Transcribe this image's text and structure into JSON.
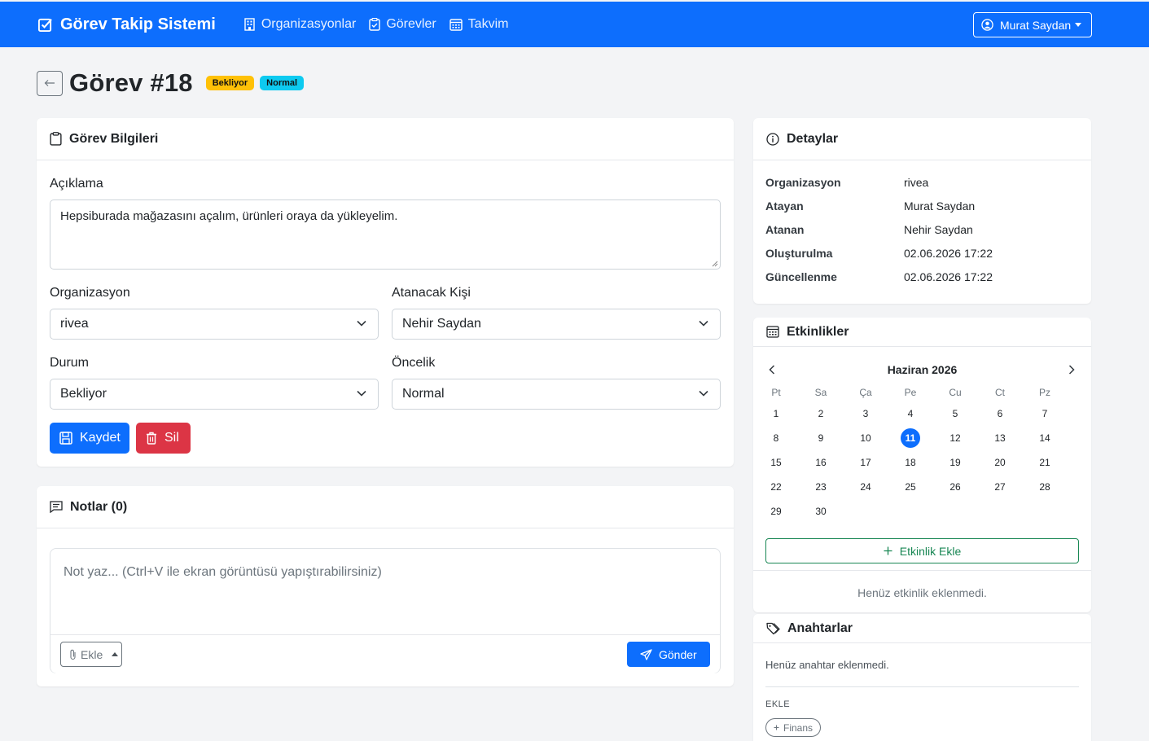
{
  "navbar": {
    "brand": "Görev Takip Sistemi",
    "links": [
      "Organizasyonlar",
      "Görevler",
      "Takvim"
    ],
    "user": "Murat Saydan"
  },
  "page": {
    "title": "Görev #18",
    "status_badge": "Bekliyor",
    "priority_badge": "Normal"
  },
  "task_info": {
    "title": "Görev Bilgileri",
    "description_label": "Açıklama",
    "description": "Hepsiburada mağazasını açalım, ürünleri oraya da yükleyelim.",
    "organization_label": "Organizasyon",
    "organization": "rivea",
    "assignee_label": "Atanacak Kişi",
    "assignee": "Nehir Saydan",
    "status_label": "Durum",
    "status": "Bekliyor",
    "priority_label": "Öncelik",
    "priority": "Normal",
    "save_label": "Kaydet",
    "delete_label": "Sil"
  },
  "notes": {
    "title": "Notlar (0)",
    "placeholder": "Not yaz... (Ctrl+V ile ekran görüntüsü yapıştırabilirsiniz)",
    "attach_label": "Ekle",
    "send_label": "Gönder"
  },
  "details": {
    "title": "Detaylar",
    "rows": [
      {
        "key": "Organizasyon",
        "value": "rivea"
      },
      {
        "key": "Atayan",
        "value": "Murat Saydan"
      },
      {
        "key": "Atanan",
        "value": "Nehir Saydan"
      },
      {
        "key": "Oluşturulma",
        "value": "02.06.2026 17:22"
      },
      {
        "key": "Güncellenme",
        "value": "02.06.2026 17:22"
      }
    ]
  },
  "events": {
    "title": "Etkinlikler",
    "month": "Haziran 2026",
    "weekdays": [
      "Pt",
      "Sa",
      "Ça",
      "Pe",
      "Cu",
      "Ct",
      "Pz"
    ],
    "days_in_month": 30,
    "first_weekday_index": 0,
    "today": 11,
    "add_label": "Etkinlik Ekle",
    "empty": "Henüz etkinlik eklenmedi."
  },
  "keywords": {
    "title": "Anahtarlar",
    "empty": "Henüz anahtar eklenmedi.",
    "add_heading": "EKLE",
    "suggestion": "Finans"
  },
  "colors": {
    "primary": "#0d6efd",
    "danger": "#dc3545",
    "warning": "#ffc107",
    "info": "#0dcaf0",
    "success": "#198754"
  }
}
